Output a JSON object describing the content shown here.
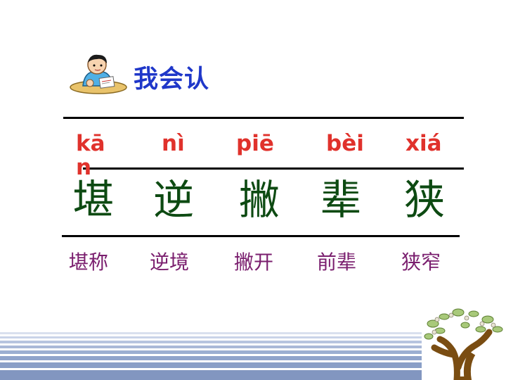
{
  "header": {
    "title": "我会认",
    "icon": "student-reading-icon"
  },
  "items": [
    {
      "pinyin": "kān",
      "char": "堪",
      "word": "堪称"
    },
    {
      "pinyin": "nì",
      "char": "逆",
      "word": "逆境"
    },
    {
      "pinyin": "piē",
      "char": "撇",
      "word": "撇开"
    },
    {
      "pinyin": "bèi",
      "char": "辈",
      "word": "前辈"
    },
    {
      "pinyin": "xiá",
      "char": "狭",
      "word": "狭窄"
    }
  ],
  "colors": {
    "title": "#1f37c9",
    "pinyin": "#e0322c",
    "character": "#0d4a12",
    "word": "#7a1e6e",
    "stripe": "#8fa3c6"
  },
  "decorations": {
    "bottom_right": "tree-icon"
  }
}
